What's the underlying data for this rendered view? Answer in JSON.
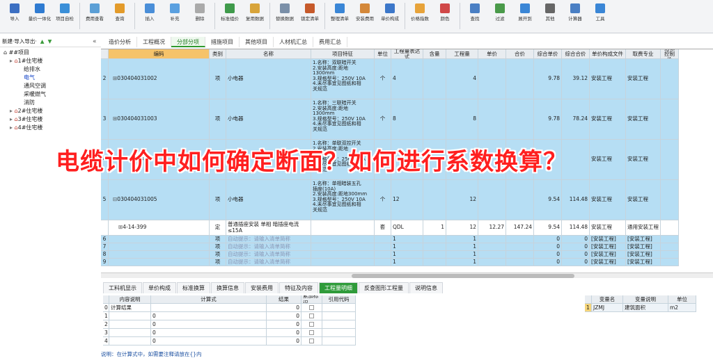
{
  "toolbar": {
    "buttons": [
      "导入",
      "量价一体化",
      "项目自检",
      "费用查看",
      "查询",
      "插入",
      "补充",
      "删除",
      "标准组价",
      "复用数据",
      "替换数据",
      "锁定清单",
      "整理清单",
      "安装费用",
      "单价构成",
      "价格指数",
      "颜色",
      "查找",
      "过滤",
      "展开到",
      "其他",
      "计算器",
      "工具"
    ],
    "colors": [
      "#3c6fc2",
      "#2f7bd1",
      "#3a8fd8",
      "#5b9fd6",
      "#e39b2b",
      "#4a8ed8",
      "#5aa0e0",
      "#aaaaaa",
      "#3f9a4b",
      "#d8a43a",
      "#7a8fa8",
      "#c65a2b",
      "#3a86d6",
      "#d4883a",
      "#3c77c9",
      "#e7a33a",
      "#d04848",
      "#4a7fc4",
      "#4a9a4a",
      "#3a86d6",
      "#666666",
      "#4a7fc4",
      "#3a86d6"
    ]
  },
  "left": {
    "header": "新建·导入导出·",
    "tree": [
      {
        "label": "##项目",
        "level": 0
      },
      {
        "label": "1#住宅楼",
        "level": 1
      },
      {
        "label": "给排水",
        "level": 2
      },
      {
        "label": "电气",
        "level": 2,
        "selected": true
      },
      {
        "label": "通风空调",
        "level": 2
      },
      {
        "label": "采暖燃气",
        "level": 2
      },
      {
        "label": "消防",
        "level": 2
      },
      {
        "label": "2#住宅楼",
        "level": 1
      },
      {
        "label": "3#住宅楼",
        "level": 1
      },
      {
        "label": "4#住宅楼",
        "level": 1
      }
    ]
  },
  "tabs": [
    "造价分析",
    "工程概况",
    "分部分项",
    "措施项目",
    "其他项目",
    "人材机汇总",
    "费用汇总"
  ],
  "grid": {
    "headers": [
      "",
      "编码",
      "类别",
      "名称",
      "项目特征",
      "单位",
      "工程量表达式",
      "含量",
      "工程量",
      "单价",
      "合价",
      "综合单价",
      "综合合价",
      "单价构成文件",
      "取费专业",
      "招标控制价"
    ],
    "rows": [
      {
        "no": "2",
        "code": "030404031002",
        "type": "项",
        "name": "小电器",
        "feat": "1.名称：双联暗开关\n2.安装高度:距地\n1300mm\n3.规格型号：250V 10A\n4.未尽事宜见图纸和相\n关规范",
        "unit": "个",
        "expr": "4",
        "qty": "",
        "amount": "4",
        "price": "",
        "total": "",
        "uprice": "9.78",
        "utotal": "39.12",
        "file": "安装工程",
        "major": "安装工程",
        "style": "blue"
      },
      {
        "no": "3",
        "code": "030404031003",
        "type": "项",
        "name": "小电器",
        "feat": "1.名称：三联暗开关\n2.安装高度:距地\n1300mm\n3.规格型号：250V 10A\n4.未尽事宜见图纸和相\n关规范",
        "unit": "个",
        "expr": "8",
        "qty": "",
        "amount": "8",
        "price": "",
        "total": "",
        "uprice": "9.78",
        "utotal": "78.24",
        "file": "安装工程",
        "major": "安装工程",
        "style": "blue"
      },
      {
        "no": "4",
        "code": "030404031004",
        "type": "项",
        "name": "小电器",
        "feat": "1.名称：单联双控开关\n2.安装高度:距地\n1300mm\n3.规格型号：250V 10A\n4.未尽事宜见图纸和相\n关规范",
        "unit": "个",
        "expr": "",
        "qty": "",
        "amount": "",
        "price": "",
        "total": "",
        "uprice": "",
        "utotal": "",
        "file": "安装工程",
        "major": "安装工程",
        "style": "blue"
      },
      {
        "no": "5",
        "code": "030404031005",
        "type": "项",
        "name": "小电器",
        "feat": "1.名称：单相暗装五孔\n插座(10A)\n2.安装高度:距地300mm\n3.规格型号：250V 10A\n4.未尽事宜见图纸和相\n关规范",
        "unit": "个",
        "expr": "12",
        "qty": "",
        "amount": "12",
        "price": "",
        "total": "",
        "uprice": "9.54",
        "utotal": "114.48",
        "file": "安装工程",
        "major": "安装工程",
        "style": "blue"
      },
      {
        "no": "",
        "code": "4-14-399",
        "type": "定",
        "name": "普通插座安装 单相 暗插座电流≤15A",
        "feat": "",
        "unit": "套",
        "expr": "QDL",
        "qty": "1",
        "amount": "12",
        "price": "12.27",
        "total": "147.24",
        "uprice": "9.54",
        "utotal": "114.48",
        "file": "安装工程",
        "major": "通用安装工程",
        "style": "white"
      },
      {
        "no": "6",
        "code": "",
        "type": "项",
        "name": "自动提示：请输入清单简称",
        "feat": "",
        "unit": "",
        "expr": "1",
        "qty": "",
        "amount": "1",
        "price": "",
        "total": "",
        "uprice": "0",
        "utotal": "0",
        "file": "[安装工程]",
        "major": "[安装工程]",
        "style": "blue"
      },
      {
        "no": "7",
        "code": "",
        "type": "项",
        "name": "自动提示：请输入清单简称",
        "feat": "",
        "unit": "",
        "expr": "1",
        "qty": "",
        "amount": "1",
        "price": "",
        "total": "",
        "uprice": "0",
        "utotal": "0",
        "file": "[安装工程]",
        "major": "[安装工程]",
        "style": "blue"
      },
      {
        "no": "8",
        "code": "",
        "type": "项",
        "name": "自动提示：请输入清单简称",
        "feat": "",
        "unit": "",
        "expr": "1",
        "qty": "",
        "amount": "1",
        "price": "",
        "total": "",
        "uprice": "0",
        "utotal": "0",
        "file": "[安装工程]",
        "major": "[安装工程]",
        "style": "blue"
      },
      {
        "no": "9",
        "code": "",
        "type": "项",
        "name": "自动提示：请输入清单简称",
        "feat": "",
        "unit": "",
        "expr": "1",
        "qty": "",
        "amount": "1",
        "price": "",
        "total": "",
        "uprice": "0",
        "utotal": "0",
        "file": "[安装工程]",
        "major": "[安装工程]",
        "style": "blue"
      }
    ]
  },
  "lower_tabs": [
    "工料机显示",
    "单价构成",
    "标准换算",
    "换算信息",
    "安装费用",
    "特征及内容",
    "工程量明细",
    "反查图形工程量",
    "说明信息"
  ],
  "lower_grid": {
    "headers": [
      "",
      "内容说明",
      "计算式",
      "结果",
      "累加标识",
      "引用代码"
    ],
    "rows": [
      {
        "no": "0",
        "desc": "计算结果",
        "formula": "",
        "result": "0"
      },
      {
        "no": "1",
        "desc": "",
        "formula": "0",
        "result": "0"
      },
      {
        "no": "2",
        "desc": "",
        "formula": "0",
        "result": "0"
      },
      {
        "no": "3",
        "desc": "",
        "formula": "0",
        "result": "0"
      },
      {
        "no": "4",
        "desc": "",
        "formula": "0",
        "result": "0"
      }
    ]
  },
  "var_grid": {
    "headers": [
      "",
      "变量名",
      "变量说明",
      "单位"
    ],
    "rows": [
      {
        "no": "1",
        "name": "JZMJ",
        "desc": "建筑面积",
        "unit": "m2"
      }
    ]
  },
  "status": "说明：在计算式中，如需要注释请放在{}内",
  "overlay": "电缆计价中如何确定断面？如何进行系数换算？"
}
